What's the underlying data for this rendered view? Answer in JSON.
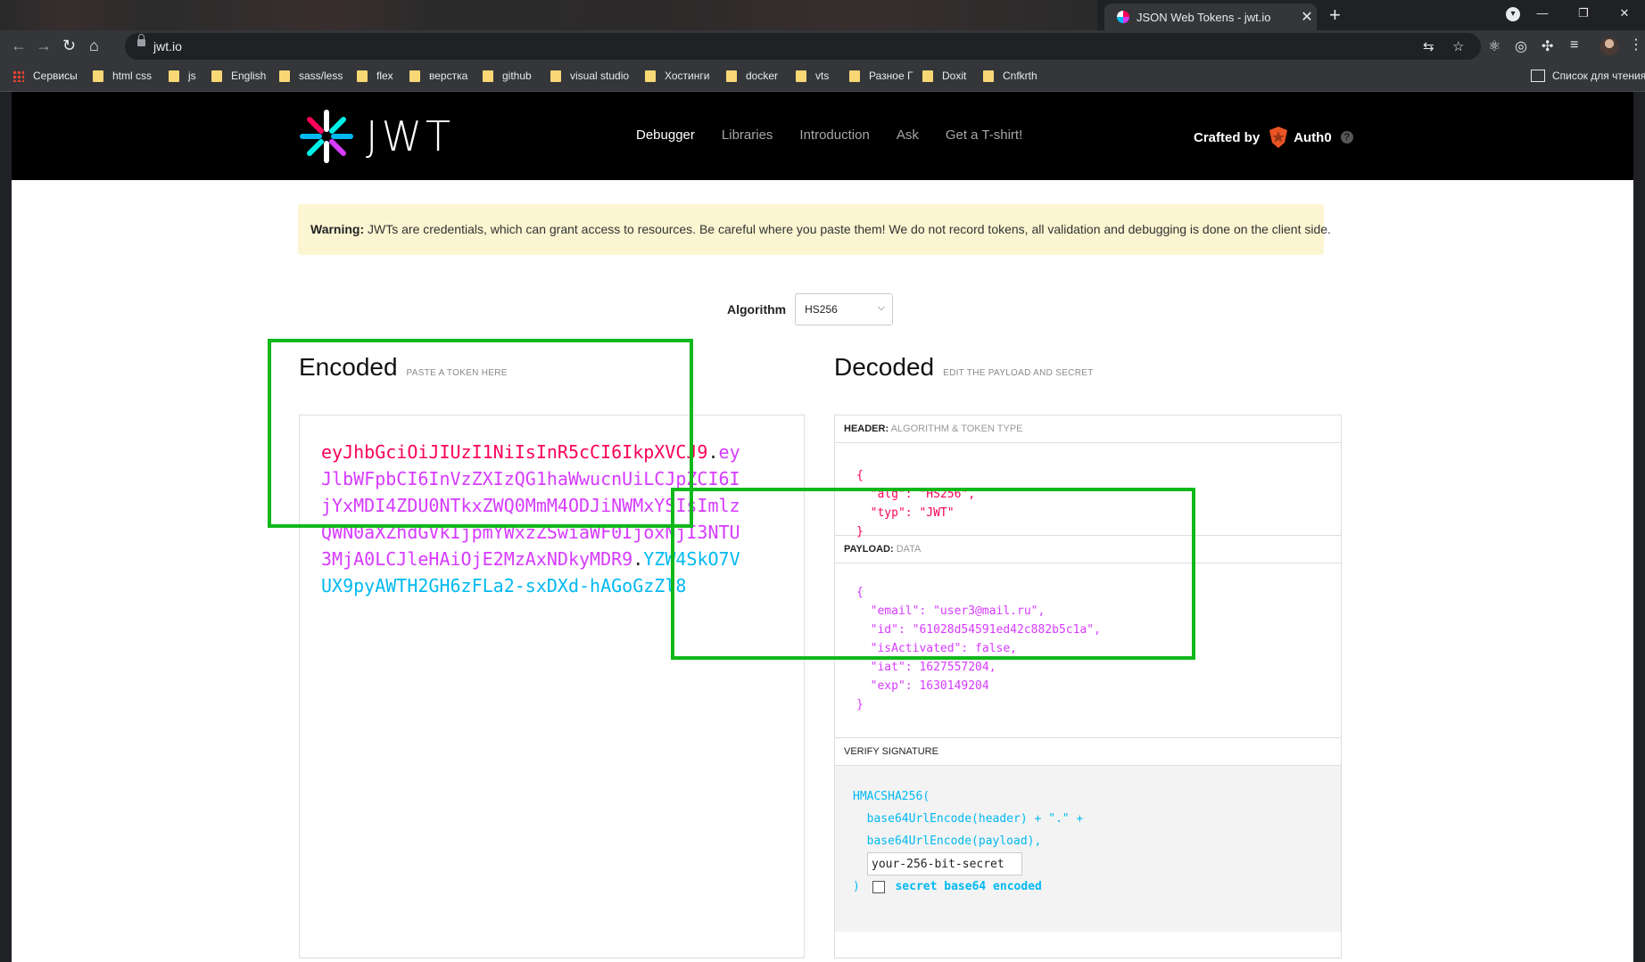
{
  "browser": {
    "tab_title": "JSON Web Tokens - jwt.io",
    "url": "jwt.io",
    "bookmarks": [
      "Сервисы",
      "html css",
      "js",
      "English",
      "sass/less",
      "flex",
      "верстка",
      "github",
      "visual studio",
      "Хостинги",
      "docker",
      "vts",
      "Разное Г",
      "Doxit",
      "Cnfkrth"
    ],
    "reading_list": "Список для чтения"
  },
  "site": {
    "logo_text": "JWT",
    "nav": [
      "Debugger",
      "Libraries",
      "Introduction",
      "Ask",
      "Get a T-shirt!"
    ],
    "crafted_by": "Crafted by",
    "brand": "Auth0"
  },
  "warning": {
    "label": "Warning:",
    "text": "JWTs are credentials, which can grant access to resources. Be careful where you paste them! We do not record tokens, all validation and debugging is done on the client side."
  },
  "algorithm": {
    "label": "Algorithm",
    "value": "HS256"
  },
  "encoded": {
    "title": "Encoded",
    "hint": "PASTE A TOKEN HERE",
    "header_part": "eyJhbGciOiJIUzI1NiIsInR5cCI6IkpXVCJ9",
    "payload_part": "eyJlbWFpbCI6InVzZXIzQG1haWwucnUiLCJpZCI6IjYxMDI4ZDU0NTkxZWQ0MmM4ODJiNWMxYSIsImlzQWN0aXZhdGVkIjpmYWxzZSwiaWF0IjoxNjI3NTU3MjA0LCJleHAiOjE2MzAxNDkyMDR9",
    "signature_part": "YZW4SkO7VUX9pyAWTH2GH6zFLa2-sxDXd-hAGoGzZl8",
    "dot": "."
  },
  "decoded": {
    "title": "Decoded",
    "hint": "EDIT THE PAYLOAD AND SECRET",
    "header_label": "HEADER:",
    "header_sub": "ALGORITHM & TOKEN TYPE",
    "header_lines": [
      "{",
      "  \"alg\": \"HS256\",",
      "  \"typ\": \"JWT\"",
      "}"
    ],
    "payload_label": "PAYLOAD:",
    "payload_sub": "DATA",
    "payload_lines": [
      "{",
      "  \"email\": \"user3@mail.ru\",",
      "  \"id\": \"61028d54591ed42c882b5c1a\",",
      "  \"isActivated\": false,",
      "  \"iat\": 1627557204,",
      "  \"exp\": 1630149204",
      "}"
    ],
    "verify_label": "VERIFY SIGNATURE",
    "verify_lines": [
      "HMACSHA256(",
      "  base64UrlEncode(header) + \".\" +",
      "  base64UrlEncode(payload),"
    ],
    "secret_value": "your-256-bit-secret",
    "close_paren": ")",
    "secret_b64_label": "secret base64 encoded"
  }
}
